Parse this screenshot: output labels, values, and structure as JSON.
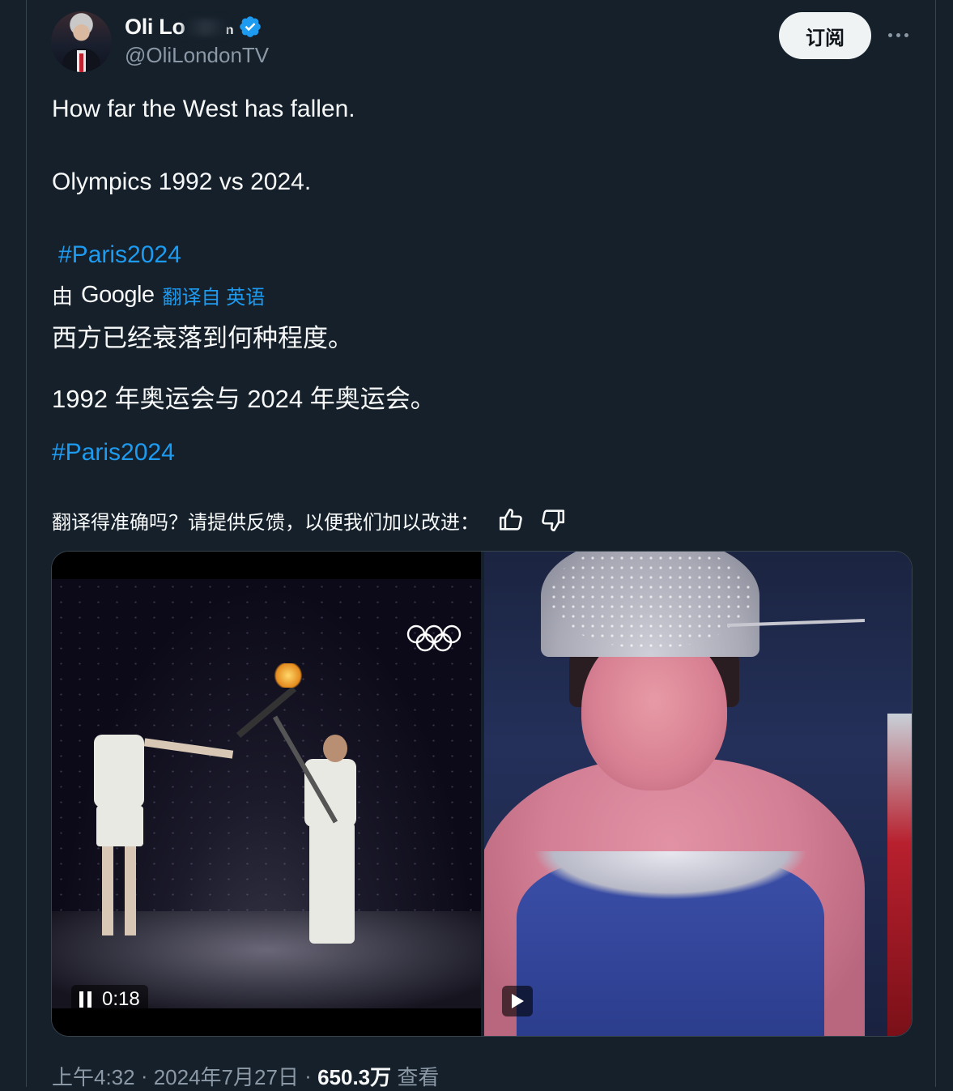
{
  "author": {
    "display_name": "Oli Lo",
    "display_name_tail": "n",
    "handle": "@OliLondonTV",
    "verified": true
  },
  "header": {
    "subscribe_label": "订阅",
    "more_label": "more"
  },
  "tweet": {
    "line1": "How far the West has fallen.",
    "line2": "Olympics 1992 vs 2024.",
    "hashtag": "#Paris2024"
  },
  "translation": {
    "by_label": "由",
    "provider": "Google",
    "translated_from": "翻译自 英语",
    "line1": "西方已经衰落到何种程度。",
    "line2": "1992 年奥运会与 2024 年奥运会。",
    "hashtag": "#Paris2024",
    "feedback_prompt": "翻译得准确吗？请提供反馈，以便我们加以改进："
  },
  "media": {
    "left_video_duration": "0:18"
  },
  "meta": {
    "time": "上午4:32",
    "sep1": " · ",
    "date": "2024年7月27日",
    "sep2": " · ",
    "views": "650.3万",
    "views_label": " 查看"
  },
  "colors": {
    "background": "#15202b",
    "link": "#1d9bf0",
    "muted": "#8b98a5",
    "text": "#f7f9f9",
    "verified_badge": "#1d9bf0"
  }
}
